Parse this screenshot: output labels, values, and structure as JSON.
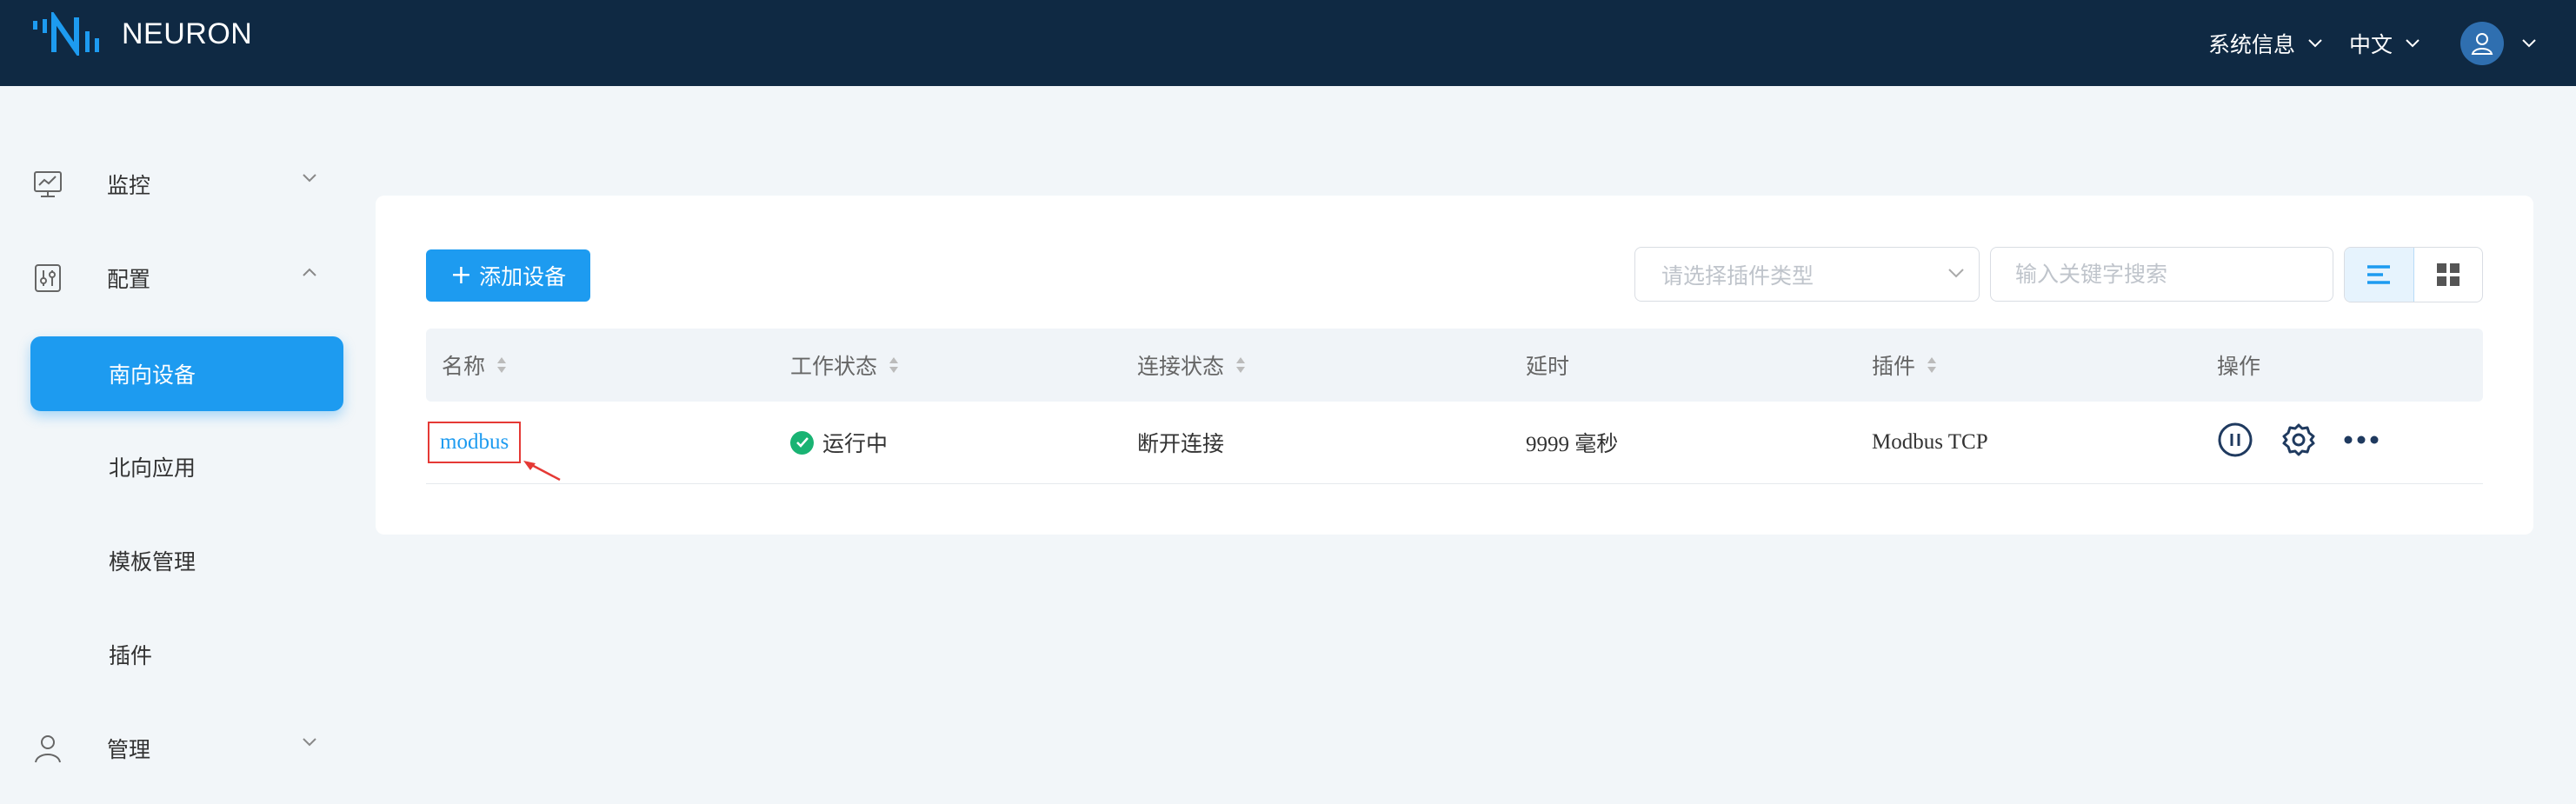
{
  "app": {
    "brand": "NEURON"
  },
  "header": {
    "system_info": "系统信息",
    "language": "中文",
    "avatar_icon": "user-icon"
  },
  "sidebar": {
    "monitor": {
      "label": "监控",
      "icon": "monitor-icon"
    },
    "config": {
      "label": "配置",
      "icon": "settings-sliders-icon"
    },
    "sub_items": [
      {
        "label": "南向设备",
        "active": true
      },
      {
        "label": "北向应用"
      },
      {
        "label": "模板管理"
      },
      {
        "label": "插件"
      }
    ],
    "admin": {
      "label": "管理",
      "icon": "user-icon"
    }
  },
  "toolbar": {
    "add_button": "添加设备",
    "plugin_select_placeholder": "请选择插件类型",
    "search_placeholder": "输入关键字搜索",
    "view_list_icon": "list-view-icon",
    "view_card_icon": "grid-view-icon"
  },
  "table": {
    "columns": [
      "名称",
      "工作状态",
      "连接状态",
      "延时",
      "插件",
      "操作"
    ],
    "rows": [
      {
        "name": "modbus",
        "work_status": "运行中",
        "connection_status": "断开连接",
        "latency": "9999 毫秒",
        "plugin": "Modbus TCP",
        "actions": [
          "pause-icon",
          "gear-icon",
          "more-icon"
        ]
      }
    ]
  },
  "colors": {
    "topbar": "#0f2943",
    "primary": "#1d9bf0",
    "running": "#19b373",
    "highlight_box": "#e53935"
  }
}
